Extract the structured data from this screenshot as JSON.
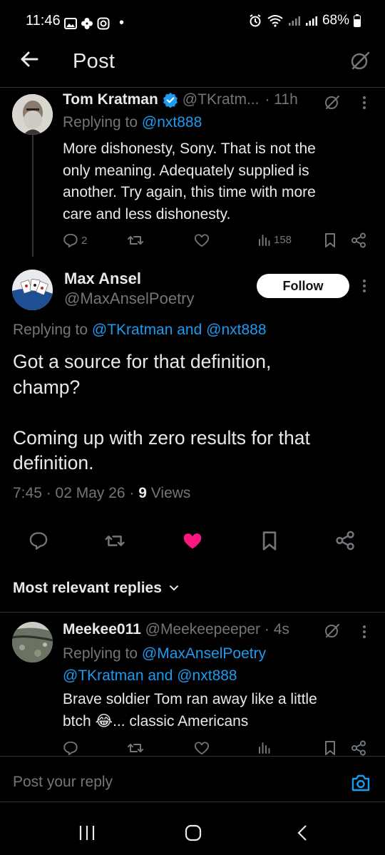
{
  "status": {
    "time": "11:46",
    "battery": "68%"
  },
  "header": {
    "title": "Post"
  },
  "parent_tweet": {
    "name": "Tom Kratman",
    "handle": "@TKratm...",
    "time": "· 11h",
    "replying_label": "Replying to ",
    "replying_to": "@nxt888",
    "text_lines": [
      "More dishonesty, Sony.  That is not the",
      "only meaning.  Adequately supplied is",
      "another.  Try again, this time with more",
      "care and less dishonesty."
    ],
    "replies": "2",
    "views": "158"
  },
  "main_tweet": {
    "name": "Max Ansel",
    "handle": "@MaxAnselPoetry",
    "follow_label": "Follow",
    "replying_label": "Replying to ",
    "replying_to_1": "@TKratman",
    "and": " and ",
    "replying_to_2": "@nxt888",
    "text_lines": [
      "Got a source for that definition,",
      "champ?",
      "",
      "Coming up with zero results for that",
      "definition."
    ],
    "meta_time": "7:45 · 02 May 26 · ",
    "views_count": "9",
    "views_label": " Views",
    "liked": true
  },
  "replies_section": {
    "label": "Most relevant replies"
  },
  "reply_tweet": {
    "name": "Meekee011",
    "handle": "@Meekeepeeper",
    "time": "· 4s",
    "replying_label": "Replying to ",
    "replying_to_1": "@MaxAnselPoetry",
    "replying_to_2": "@TKratman",
    "and": " and ",
    "replying_to_3": "@nxt888",
    "text_line1": "Brave soldier Tom ran away like a little",
    "text_line2_a": "btch ",
    "text_emoji": "😂",
    "text_line2_b": "... classic Americans"
  },
  "compose": {
    "placeholder": "Post your reply"
  },
  "colors": {
    "accent": "#1d9bf0",
    "like": "#f91880",
    "muted": "#71767b",
    "text": "#e7e9ea"
  }
}
